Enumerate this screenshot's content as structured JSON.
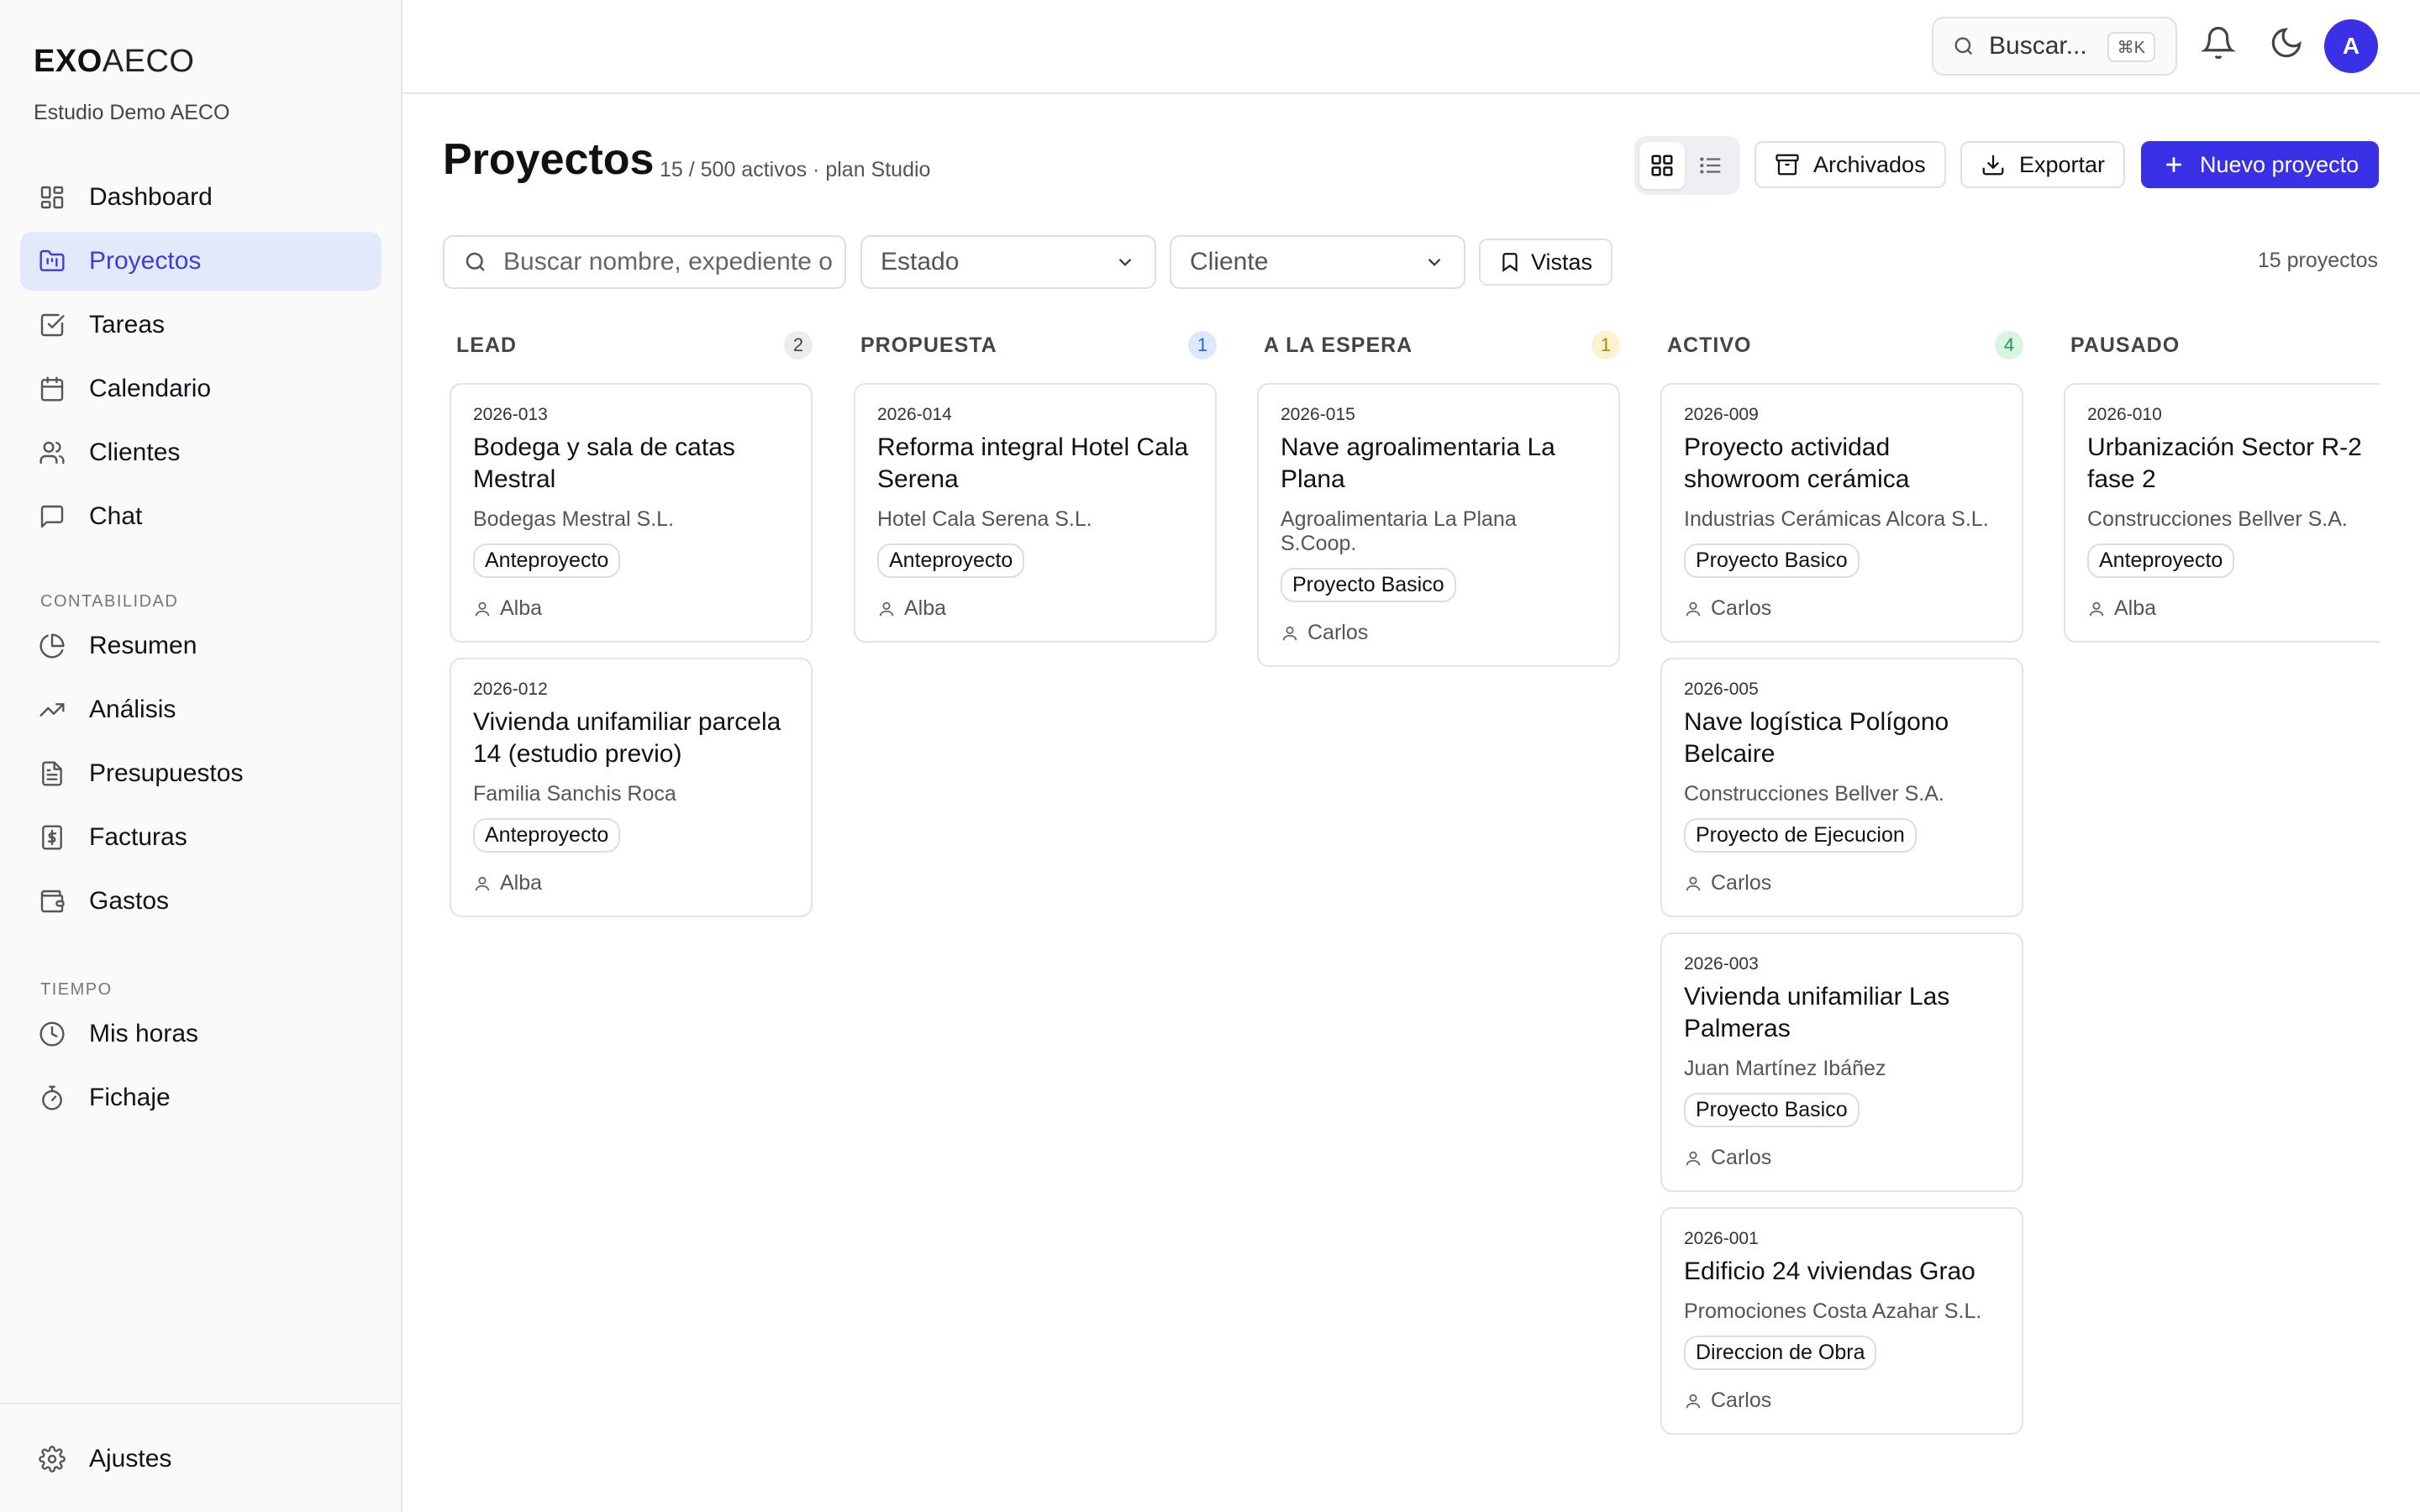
{
  "app": {
    "logo_bold": "EXO",
    "logo_light": "AECO",
    "workspace": "Estudio Demo AECO"
  },
  "sidebar": {
    "main": [
      {
        "label": "Dashboard",
        "icon": "dashboard-icon"
      },
      {
        "label": "Proyectos",
        "icon": "folder-icon",
        "active": true
      },
      {
        "label": "Tareas",
        "icon": "checkbox-icon"
      },
      {
        "label": "Calendario",
        "icon": "calendar-icon"
      },
      {
        "label": "Clientes",
        "icon": "users-icon"
      },
      {
        "label": "Chat",
        "icon": "chat-icon"
      }
    ],
    "section_accounting": "CONTABILIDAD",
    "accounting": [
      {
        "label": "Resumen",
        "icon": "pie-chart-icon"
      },
      {
        "label": "Análisis",
        "icon": "trending-up-icon"
      },
      {
        "label": "Presupuestos",
        "icon": "document-icon"
      },
      {
        "label": "Facturas",
        "icon": "invoice-icon"
      },
      {
        "label": "Gastos",
        "icon": "wallet-icon"
      }
    ],
    "section_time": "TIEMPO",
    "time": [
      {
        "label": "Mis horas",
        "icon": "clock-icon"
      },
      {
        "label": "Fichaje",
        "icon": "stopwatch-icon"
      }
    ],
    "settings_label": "Ajustes"
  },
  "topbar": {
    "search_placeholder": "Buscar...",
    "shortcut": "⌘K",
    "avatar_initial": "A"
  },
  "header": {
    "title": "Proyectos",
    "subtitle": "15 / 500 activos · plan Studio",
    "archived_label": "Archivados",
    "export_label": "Exportar",
    "new_label": "Nuevo proyecto"
  },
  "filters": {
    "search_placeholder": "Buscar nombre, expediente o",
    "status_label": "Estado",
    "client_label": "Cliente",
    "views_label": "Vistas",
    "count_text": "15 proyectos"
  },
  "colors": {
    "accent": "#3a31e6",
    "active_bg": "#e4e8fb"
  },
  "board": {
    "columns": [
      {
        "title": "LEAD",
        "count": "2",
        "count_bg": "#ececef",
        "count_fg": "#444",
        "cards": [
          {
            "code": "2026-013",
            "title": "Bodega y sala de catas Mestral",
            "client": "Bodegas Mestral S.L.",
            "phase": "Anteproyecto",
            "owner": "Alba"
          },
          {
            "code": "2026-012",
            "title": "Vivienda unifamiliar parcela 14 (estudio previo)",
            "client": "Familia Sanchis Roca",
            "phase": "Anteproyecto",
            "owner": "Alba"
          }
        ]
      },
      {
        "title": "PROPUESTA",
        "count": "1",
        "count_bg": "#dde9fb",
        "count_fg": "#2b64c9",
        "cards": [
          {
            "code": "2026-014",
            "title": "Reforma integral Hotel Cala Serena",
            "client": "Hotel Cala Serena S.L.",
            "phase": "Anteproyecto",
            "owner": "Alba"
          }
        ]
      },
      {
        "title": "A LA ESPERA",
        "count": "1",
        "count_bg": "#fdf1cf",
        "count_fg": "#b58309",
        "cards": [
          {
            "code": "2026-015",
            "title": "Nave agroalimentaria La Plana",
            "client": "Agroalimentaria La Plana S.Coop.",
            "phase": "Proyecto Basico",
            "owner": "Carlos"
          }
        ]
      },
      {
        "title": "ACTIVO",
        "count": "4",
        "count_bg": "#daf4e3",
        "count_fg": "#1f9a4c",
        "cards": [
          {
            "code": "2026-009",
            "title": "Proyecto actividad showroom cerámica",
            "client": "Industrias Cerámicas Alcora S.L.",
            "phase": "Proyecto Basico",
            "owner": "Carlos"
          },
          {
            "code": "2026-005",
            "title": "Nave logística Polígono Belcaire",
            "client": "Construcciones Bellver S.A.",
            "phase": "Proyecto de Ejecucion",
            "owner": "Carlos"
          },
          {
            "code": "2026-003",
            "title": "Vivienda unifamiliar Las Palmeras",
            "client": "Juan Martínez Ibáñez",
            "phase": "Proyecto Basico",
            "owner": "Carlos"
          },
          {
            "code": "2026-001",
            "title": "Edificio 24 viviendas Grao",
            "client": "Promociones Costa Azahar S.L.",
            "phase": "Direccion de Obra",
            "owner": "Carlos"
          }
        ]
      },
      {
        "title": "PAUSADO",
        "count": "",
        "count_bg": "",
        "count_fg": "",
        "cards": [
          {
            "code": "2026-010",
            "title": "Urbanización Sector R-2 fase 2",
            "client": "Construcciones Bellver S.A.",
            "phase": "Anteproyecto",
            "owner": "Alba"
          }
        ]
      }
    ]
  }
}
